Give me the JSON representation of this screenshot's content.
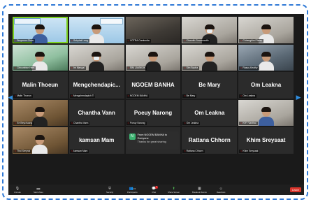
{
  "window": {
    "app": "Zoom Meeting",
    "accent": "#2f79d6",
    "active_speaker_color": "#7ed321"
  },
  "row1": [
    {
      "label": "Sreymom Chea"
    },
    {
      "label": "Sokphal Leng"
    },
    {
      "label": "VOTRA Cambodia"
    },
    {
      "label": "Chanrith Sovannarith"
    },
    {
      "label": "Chhengkim Pheap"
    }
  ],
  "row2": [
    {
      "label": "Chivorleine Hem"
    },
    {
      "label": "Im Mangai"
    },
    {
      "label": "SIM LAMWOK"
    },
    {
      "label": "Sim Bopha"
    },
    {
      "label": "Rasuy Keothy"
    }
  ],
  "row3": [
    {
      "name": "Malin Thoeun",
      "label": "Malin Thoeun"
    },
    {
      "name": "Mengchendapic...",
      "label": "Mengchendapich Ti"
    },
    {
      "name": "NGOEM BANHA",
      "label": "NGOEM BANHA"
    },
    {
      "name": "Be Mary",
      "label": "Be Mary"
    },
    {
      "name": "Om Leakna",
      "label": "Om Leakna"
    }
  ],
  "row4": [
    {
      "label": "Ee Beychuong"
    },
    {
      "name": "Chantha Vann",
      "label": "Chantha Vann"
    },
    {
      "name": "Poeuy Narong",
      "label": "Poeuy Narong"
    },
    {
      "name": "Om Leakna",
      "label": "Om Leakna"
    },
    {
      "label": "KHY Vanthai"
    }
  ],
  "row5": [
    {
      "label": "Thol Sreynoi"
    },
    {
      "name": "kamsan Mam",
      "label": "kamsan Mam"
    },
    {
      "label": ""
    },
    {
      "name": "Rattana Chhorn",
      "label": "Rattana Chhorn"
    },
    {
      "name": "Khim Sreysaat",
      "label": "Khim Sreysaat"
    }
  ],
  "chat": {
    "avatar": "N",
    "from": "From NGOEM BANHA to Everyone",
    "message": "Thanks for great sharing"
  },
  "toolbar": {
    "unmute": "Unmute",
    "start_video": "Start Video",
    "security": "Security",
    "participants": "Participants",
    "participants_count": "24",
    "chat": "Chat",
    "chat_badge": "1",
    "share_screen": "Share Screen",
    "breakout": "Breakout Rooms",
    "reactions": "Reactions",
    "leave": "Leave"
  }
}
